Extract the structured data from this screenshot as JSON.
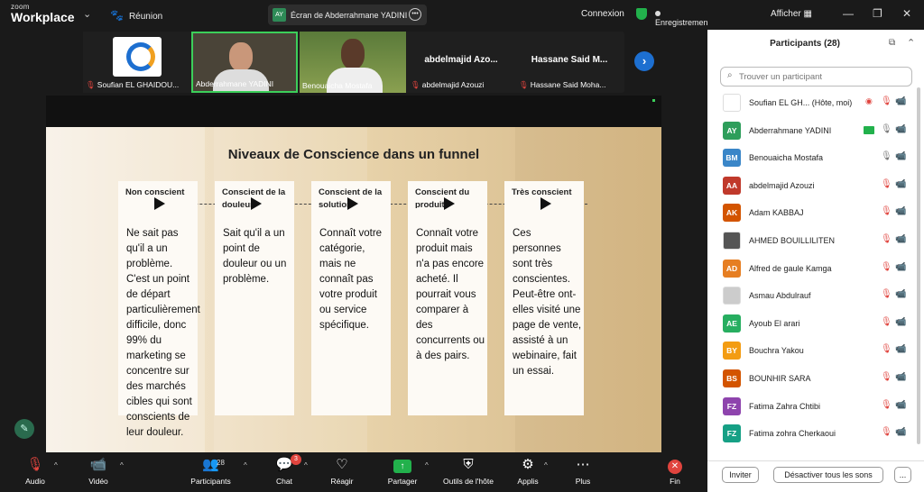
{
  "app": {
    "logo_top": "zoom",
    "logo_bottom": "Workplace",
    "meeting_label": "Réunion"
  },
  "share_banner": {
    "avatar": "AY",
    "text": "Écran de Abderrahmane YADINI"
  },
  "status": {
    "connection": "Connexion",
    "recording": "Enregistrement...",
    "show": "Afficher"
  },
  "video_tiles": [
    {
      "name": "Soufian EL GHAIDOU...",
      "muted": true,
      "type": "logo"
    },
    {
      "name": "Abderrahmane YADINI",
      "muted": false,
      "type": "video",
      "active": true
    },
    {
      "name": "Benouaicha Mostafa",
      "muted": false,
      "type": "video"
    },
    {
      "name": "abdelmajid Azouzi",
      "big": "abdelmajid Azo...",
      "muted": true,
      "type": "name"
    },
    {
      "name": "Hassane Said Moha...",
      "big": "Hassane Said M...",
      "muted": true,
      "type": "name"
    }
  ],
  "slide": {
    "title": "Niveaux de Conscience dans un funnel",
    "columns": [
      {
        "heading": "Non conscient",
        "body": "Ne sait pas qu'il a un problème. C'est un point de départ particulièrement difficile, donc 99% du marketing se concentre sur des marchés cibles qui sont conscients de leur douleur."
      },
      {
        "heading": "Conscient de la douleur",
        "body": "Sait qu'il a un point de douleur ou un problème."
      },
      {
        "heading": "Conscient de la solution",
        "body": "Connaît votre catégorie, mais ne connaît pas votre produit ou service spécifique."
      },
      {
        "heading": "Conscient du produit",
        "body": "Connaît votre produit mais n'a pas encore acheté. Il pourrait vous comparer à des concurrents ou à des pairs."
      },
      {
        "heading": "Très conscient",
        "body": "Ces personnes sont très conscientes. Peut-être ont-elles visité une page de vente, assisté à un webinaire, fait un essai."
      }
    ]
  },
  "toolbar": {
    "audio": "Audio",
    "video": "Vidéo",
    "participants": "Participants",
    "participants_count": "28",
    "chat": "Chat",
    "chat_badge": "3",
    "react": "Réagir",
    "share": "Partager",
    "host_tools": "Outils de l'hôte",
    "apps": "Applis",
    "more": "Plus",
    "end": "Fin"
  },
  "panel": {
    "title": "Participants (28)",
    "search_placeholder": "Trouver un participant",
    "participants": [
      {
        "initials": "",
        "name": "Soufian EL GH...  (Hôte, moi)",
        "color": "#ffffff",
        "photo": true,
        "icons": [
          "rec",
          "mic-off",
          "cam-off"
        ]
      },
      {
        "initials": "AY",
        "name": "Abderrahmane YADINI",
        "color": "#2e9e5b",
        "icons": [
          "share",
          "mic",
          "cam"
        ]
      },
      {
        "initials": "BM",
        "name": "Benouaicha Mostafa",
        "color": "#3a86c8",
        "icons": [
          "mic",
          "cam"
        ]
      },
      {
        "initials": "AA",
        "name": "abdelmajid Azouzi",
        "color": "#c0392b",
        "icons": [
          "mic-off",
          "cam-off"
        ]
      },
      {
        "initials": "AK",
        "name": "Adam KABBAJ",
        "color": "#d35400",
        "icons": [
          "mic-off",
          "cam-off"
        ]
      },
      {
        "initials": "",
        "name": "AHMED BOUILLILITEN",
        "color": "#555555",
        "photo": true,
        "icons": [
          "mic-off",
          "cam-off"
        ]
      },
      {
        "initials": "AD",
        "name": "Alfred de gaule Kamga",
        "color": "#e67e22",
        "icons": [
          "mic-off",
          "cam-off"
        ]
      },
      {
        "initials": "",
        "name": "Asmau Abdulrauf",
        "color": "#cccccc",
        "photo": true,
        "icons": [
          "mic-off",
          "cam-off"
        ]
      },
      {
        "initials": "AE",
        "name": "Ayoub El arari",
        "color": "#27ae60",
        "icons": [
          "mic-off",
          "cam-off"
        ]
      },
      {
        "initials": "BY",
        "name": "Bouchra Yakou",
        "color": "#f39c12",
        "icons": [
          "mic-off",
          "cam-off"
        ]
      },
      {
        "initials": "BS",
        "name": "BOUNHIR SARA",
        "color": "#d35400",
        "icons": [
          "mic-off",
          "cam-off"
        ]
      },
      {
        "initials": "FZ",
        "name": "Fatima Zahra Chtibi",
        "color": "#8e44ad",
        "icons": [
          "mic-off",
          "cam-off"
        ]
      },
      {
        "initials": "FZ",
        "name": "Fatima zohra Cherkaoui",
        "color": "#16a085",
        "icons": [
          "mic-off",
          "cam-off"
        ]
      }
    ],
    "invite": "Inviter",
    "mute_all": "Désactiver tous les sons",
    "more": "..."
  },
  "colors": {
    "accent": "#1d6fd0",
    "green": "#22b14c",
    "red": "#e0443e"
  }
}
